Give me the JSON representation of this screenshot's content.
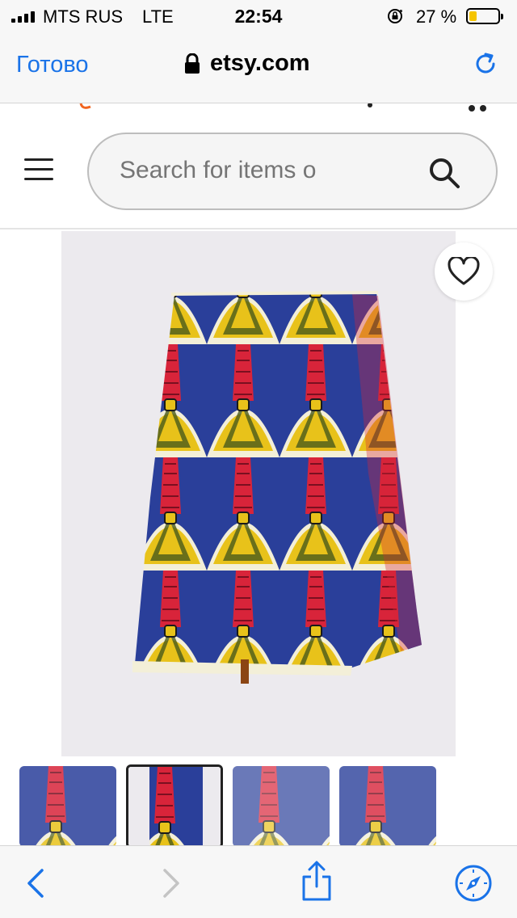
{
  "status_bar": {
    "carrier": "MTS RUS",
    "network": "LTE",
    "time": "22:54",
    "battery_percent": "27 %",
    "battery_level": 0.27
  },
  "browser": {
    "done_label": "Готово",
    "domain": "etsy.com"
  },
  "search": {
    "placeholder": "Search for items o"
  },
  "colors": {
    "safari_blue": "#1a73e8",
    "fabric_red": "#d8243a",
    "fabric_blue": "#2a3f9a",
    "fabric_yellow": "#e8c21a",
    "fabric_green": "#4a5a1a",
    "etsy_orange": "#f1641e"
  },
  "icons": {
    "menu": "hamburger-icon",
    "search": "search-icon",
    "favorite": "heart-icon",
    "back": "chevron-left-icon",
    "forward": "chevron-right-icon",
    "share": "share-icon",
    "safari": "compass-icon",
    "reload": "reload-icon"
  },
  "thumbnails": [
    {
      "label": "",
      "selected": false
    },
    {
      "label": "",
      "selected": true
    },
    {
      "label": "",
      "selected": false
    },
    {
      "label": "",
      "selected": false
    }
  ]
}
